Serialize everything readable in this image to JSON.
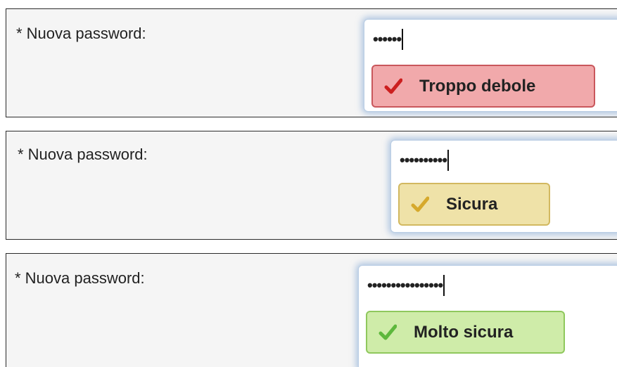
{
  "rows": [
    {
      "label": "* Nuova password:",
      "password_mask": "••••••",
      "strength": {
        "text": "Troppo debole",
        "check_color": "#cc1f1f",
        "bg": "#f1a9ab",
        "border": "#c9575c"
      }
    },
    {
      "label": "* Nuova password:",
      "password_mask": "••••••••••",
      "strength": {
        "text": "Sicura",
        "check_color": "#d6a92c",
        "bg": "#efe2a8",
        "border": "#d2b860"
      }
    },
    {
      "label": "* Nuova password:",
      "password_mask": "••••••••••••••••",
      "strength": {
        "text": "Molto sicura",
        "check_color": "#5db83c",
        "bg": "#cfeca9",
        "border": "#8fc85d"
      }
    }
  ],
  "icons": {
    "strength_indicator": "check-icon"
  }
}
